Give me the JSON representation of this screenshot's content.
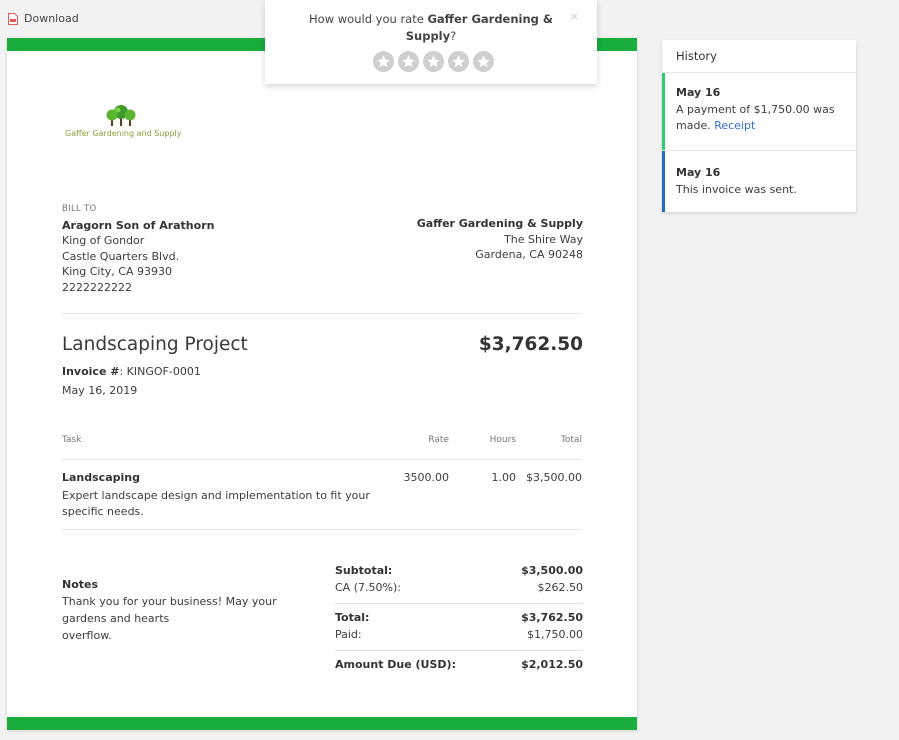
{
  "download": {
    "label": "Download"
  },
  "popup": {
    "prefix": "How would you rate ",
    "company": "Gaffer Gardening & Supply",
    "suffix": "?",
    "close": "×",
    "star_count": 5
  },
  "invoice": {
    "brand_color": "#18ad3d",
    "logo_text": "Gaffer Gardening and Supply",
    "bill_to": {
      "label": "BILL TO",
      "name": "Aragorn Son of Arathorn",
      "line1": "King of Gondor",
      "line2": "Castle Quarters Blvd.",
      "line3": "King City, CA 93930",
      "phone": "2222222222"
    },
    "from": {
      "name": "Gaffer Gardening & Supply",
      "line1": "The Shire Way",
      "line2": "Gardena, CA 90248"
    },
    "title": "Landscaping Project",
    "total_big": "$3,762.50",
    "invoice_label": "Invoice #",
    "invoice_number": ": KINGOF-0001",
    "date": "May 16, 2019",
    "columns": {
      "task": "Task",
      "rate": "Rate",
      "hours": "Hours",
      "total": "Total"
    },
    "items": [
      {
        "name": "Landscaping",
        "desc1": "Expert landscape design and implementation to fit your",
        "desc2": "specific needs.",
        "rate": "3500.00",
        "hours": "1.00",
        "total": "$3,500.00"
      }
    ],
    "notes": {
      "label": "Notes",
      "line1": "Thank you for your business! May your",
      "line2": "gardens and hearts",
      "line3": "overflow."
    },
    "totals": {
      "subtotal_label": "Subtotal:",
      "subtotal": "$3,500.00",
      "tax_label": "CA (7.50%):",
      "tax": "$262.50",
      "total_label": "Total:",
      "total": "$3,762.50",
      "paid_label": "Paid:",
      "paid": "$1,750.00",
      "due_label": "Amount Due (USD):",
      "due": "$2,012.50"
    }
  },
  "history": {
    "title": "History",
    "items": [
      {
        "date": "May 16",
        "text1": "A payment of $1,750.00 was",
        "text2": "made. ",
        "link": "Receipt",
        "color": "#2ecc71"
      },
      {
        "date": "May 16",
        "text1": "This invoice was sent.",
        "color": "#2668c4"
      }
    ],
    "link_color": "#2e6fd1"
  }
}
